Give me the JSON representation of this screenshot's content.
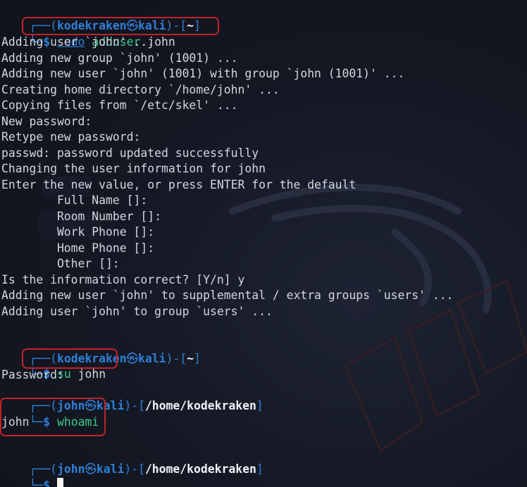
{
  "block1": {
    "prompt": {
      "tree_top": "┌──(",
      "user": "kodekraken",
      "at": "㉿",
      "host": "kali",
      "mid": ")-[",
      "path": "~",
      "end": "]"
    },
    "cmd_row": {
      "tree": "└─",
      "dollar": "$ ",
      "cmd_name": "sudo",
      "cmd_rest1": " adduser",
      "cmd_rest2": " john"
    },
    "output": [
      "Adding user `john' ...",
      "Adding new group `john' (1001) ...",
      "Adding new user `john' (1001) with group `john (1001)' ...",
      "Creating home directory `/home/john' ...",
      "Copying files from `/etc/skel' ...",
      "New password:",
      "Retype new password:",
      "passwd: password updated successfully",
      "Changing the user information for john",
      "Enter the new value, or press ENTER for the default",
      "        Full Name []:",
      "        Room Number []:",
      "        Work Phone []:",
      "        Home Phone []:",
      "        Other []:",
      "Is the information correct? [Y/n] y",
      "Adding new user `john' to supplemental / extra groups `users' ...",
      "Adding user `john' to group `users' ..."
    ]
  },
  "block2": {
    "prompt": {
      "tree_top": "┌──(",
      "user": "kodekraken",
      "at": "㉿",
      "host": "kali",
      "mid": ")-[",
      "path": "~",
      "end": "]"
    },
    "cmd_row": {
      "tree": "└─",
      "dollar": "$ ",
      "cmd_name": "su",
      "cmd_rest": " john"
    },
    "output": [
      "Password:"
    ]
  },
  "block3": {
    "prompt": {
      "tree_top": "┌──(",
      "user": "john",
      "at": "㉿",
      "host": "kali",
      "mid": ")-[",
      "path": "/home/kodekraken",
      "end": "]"
    },
    "cmd_row": {
      "tree": "└─",
      "dollar": "$ ",
      "cmd_name": "whoami"
    },
    "output": [
      "john"
    ]
  },
  "block4": {
    "prompt": {
      "tree_top": "┌──(",
      "user": "john",
      "at": "㉿",
      "host": "kali",
      "mid": ")-[",
      "path": "/home/kodekraken",
      "end": "]"
    },
    "cmd_row": {
      "tree": "└─",
      "dollar": "$ "
    }
  },
  "colors": {
    "accent": "#2f80d8",
    "command": "#3bc98b",
    "highlight": "#c2222a",
    "text": "#d3d7df",
    "background": "#10131b"
  }
}
